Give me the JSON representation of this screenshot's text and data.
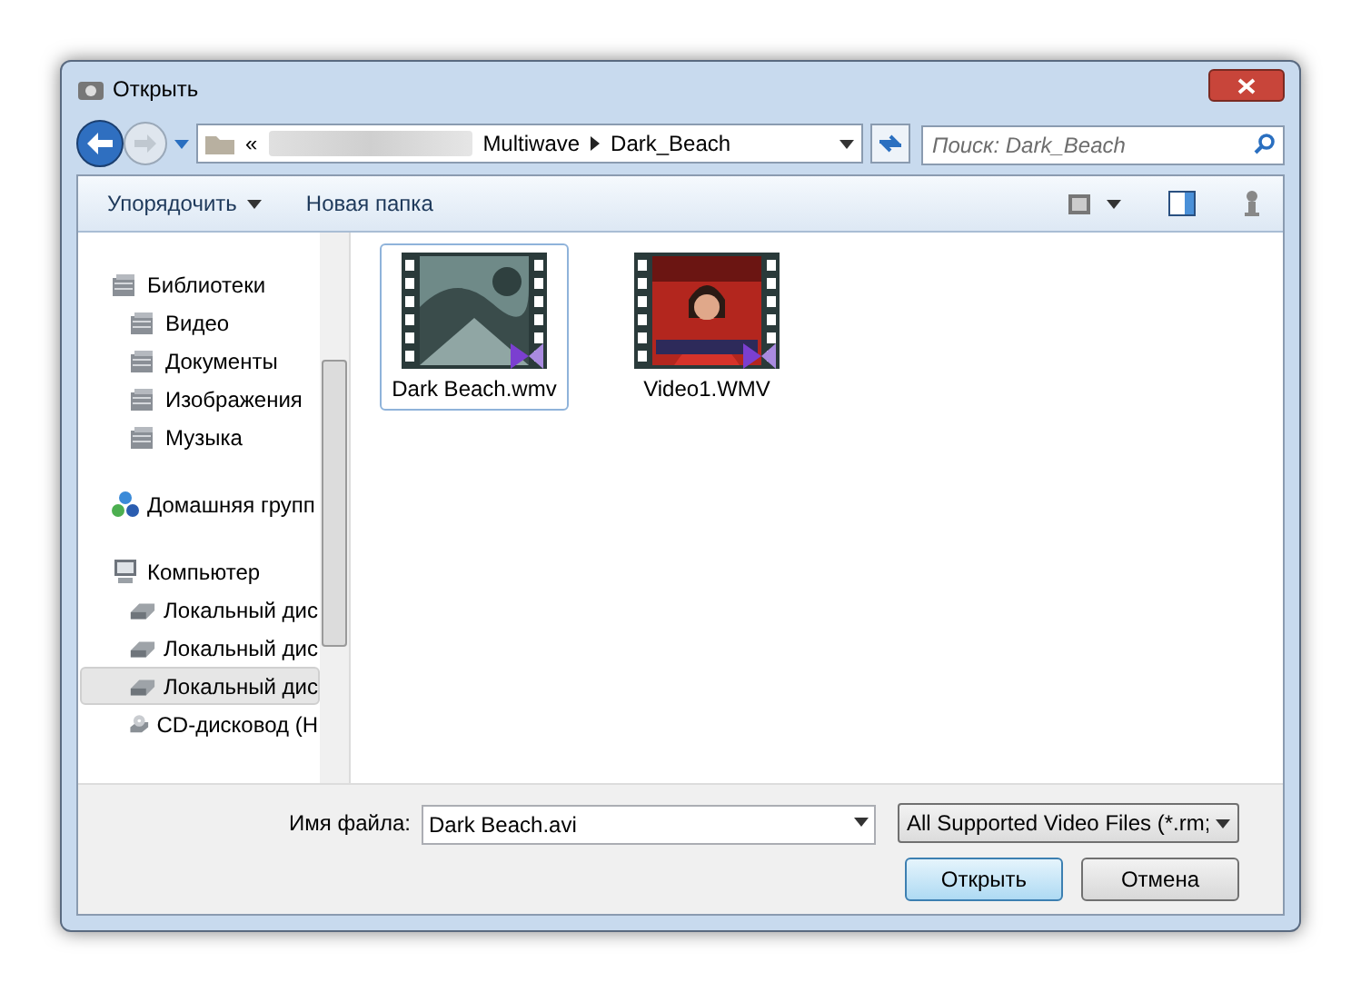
{
  "window": {
    "title": "Открыть"
  },
  "address": {
    "prefix": "«",
    "segments": [
      "Multiwave",
      "Dark_Beach"
    ]
  },
  "search": {
    "placeholder": "Поиск: Dark_Beach"
  },
  "toolbar": {
    "organize": "Упорядочить",
    "new_folder": "Новая папка"
  },
  "sidebar": {
    "items": [
      {
        "label": "Библиотеки",
        "kind": "library",
        "selected": false,
        "children": [
          {
            "label": "Видео",
            "kind": "library",
            "selected": false
          },
          {
            "label": "Документы",
            "kind": "library",
            "selected": false
          },
          {
            "label": "Изображения",
            "kind": "library",
            "selected": false
          },
          {
            "label": "Музыка",
            "kind": "library",
            "selected": false
          }
        ]
      },
      {
        "label": "Домашняя групп",
        "kind": "homegroup",
        "selected": false
      },
      {
        "label": "Компьютер",
        "kind": "computer",
        "selected": false,
        "children": [
          {
            "label": "Локальный дис",
            "kind": "disk",
            "selected": false
          },
          {
            "label": "Локальный дис",
            "kind": "disk",
            "selected": false
          },
          {
            "label": "Локальный дис",
            "kind": "disk",
            "selected": true
          },
          {
            "label": "CD-дисковод (Н",
            "kind": "cd",
            "selected": false
          }
        ]
      }
    ]
  },
  "files": [
    {
      "name": "Dark Beach.wmv",
      "kind": "dark",
      "selected": true
    },
    {
      "name": "Video1.WMV",
      "kind": "news",
      "selected": false
    }
  ],
  "filename": {
    "label": "Имя файла:",
    "value": "Dark Beach.avi"
  },
  "filetype": {
    "value": "All Supported Video Files (*.rm;"
  },
  "buttons": {
    "open": "Открыть",
    "cancel": "Отмена"
  }
}
